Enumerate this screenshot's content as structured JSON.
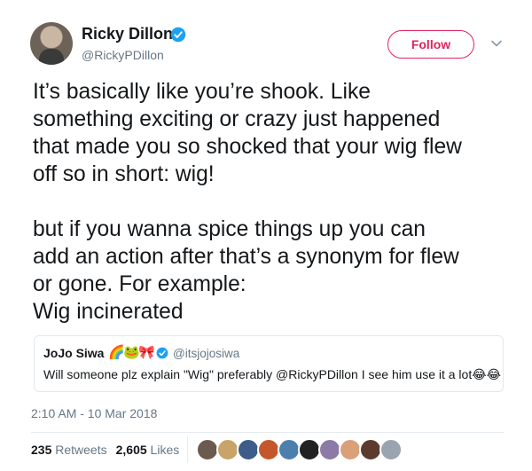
{
  "author": {
    "name": "Ricky Dillon",
    "handle": "@RickyPDillon",
    "avatar_icon": "person-avatar-icon",
    "verified_icon": "verified-badge-icon"
  },
  "follow_button": {
    "label": "Follow",
    "color": "#e0245e"
  },
  "menu_icon": "chevron-down-icon",
  "tweet": {
    "text": "It’s basically like you’re shook. Like\nsomething exciting or crazy just happened\nthat made you so shocked that your wig flew\noff so in short: wig!\n\nbut if you wanna spice things up you can\nadd an action after that’s a synonym for flew\nor gone. For example:\nWig incinerated"
  },
  "quoted_tweet": {
    "name": "JoJo Siwa",
    "name_emojis": [
      "🌈",
      "🐸",
      "🎀"
    ],
    "handle": "@itsjojosiwa",
    "text": "Will someone plz explain \"Wig\" preferably @RickyPDillon I see him use it a lot",
    "trailing_emojis": "😂😂"
  },
  "timestamp": "2:10 AM - 10 Mar 2018",
  "stats": {
    "retweets_count": "235",
    "retweets_label": "Retweets",
    "likes_count": "2,605",
    "likes_label": "Likes"
  },
  "likers": [
    "#6b5a4e",
    "#c8a46b",
    "#3d5c8a",
    "#c4582c",
    "#4c7fae",
    "#222222",
    "#8d7aa6",
    "#d9a07a",
    "#5c3a2e",
    "#9aa3b0"
  ],
  "colors": {
    "brand_blue": "#1da1f2",
    "text": "#14171a",
    "muted": "#657786",
    "border": "#e1e8ed"
  }
}
